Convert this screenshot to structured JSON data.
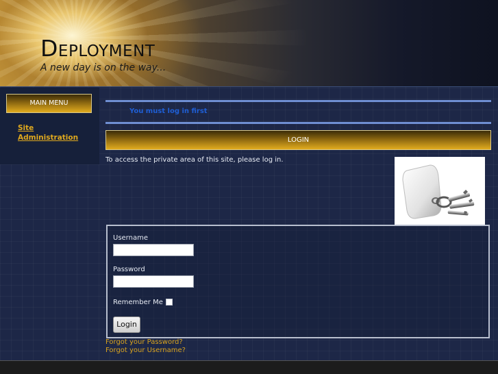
{
  "header": {
    "site_title": "Deployment",
    "tagline": "A new day is on the way..."
  },
  "sidebar": {
    "main_menu_label": "MAIN MENU",
    "items": [
      {
        "label": "Site Administration"
      }
    ]
  },
  "main": {
    "message": "You must log in first",
    "login_heading": "LOGIN",
    "intro_text": "To access the private area of this site, please log in.",
    "image_icon": "keys-image"
  },
  "form": {
    "username_label": "Username",
    "username_value": "",
    "password_label": "Password",
    "password_value": "",
    "remember_label": "Remember Me",
    "remember_checked": false,
    "submit_label": "Login"
  },
  "links": {
    "forgot_password": "Forgot your Password?",
    "forgot_username": "Forgot your Username?"
  },
  "colors": {
    "background": "#1d2747",
    "accent_gold": "#e0a91e",
    "message_blue": "#1f5fd6",
    "rule_blue": "#6f8fd3"
  }
}
